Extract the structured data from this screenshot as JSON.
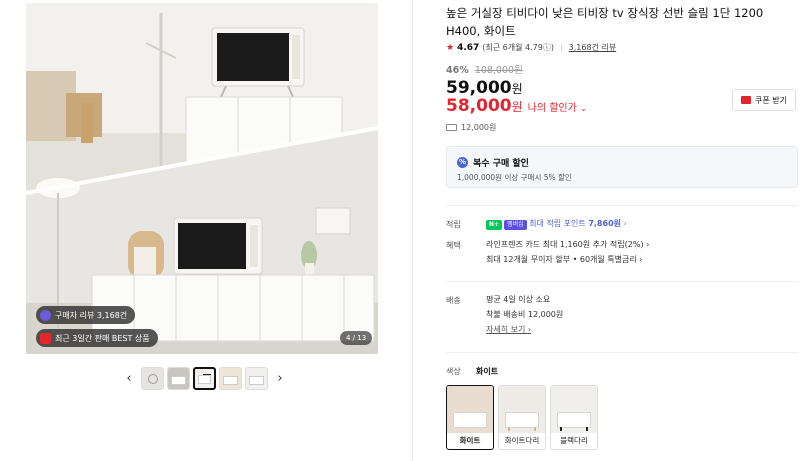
{
  "product": {
    "title": "높은 거실장 티비다이 낮은 티비장 tv 장식장 선반 슬림 1단 1200 H400, 화이트",
    "rating_score": "4.67",
    "rating_detail": "(최근 6개월 4.79ⓘ)",
    "review_count": "3,168건 리뷰",
    "discount_pct": "46%",
    "original_price": "108,000원",
    "price": "59,000",
    "price_won": "원",
    "my_price": "58,000",
    "my_price_won": "원",
    "my_discount_label": "나의 할인가",
    "coupon_label": "쿠폰 받기",
    "shipping_fee": "12,000원"
  },
  "gallery": {
    "badge_reviews": "구매자 리뷰 3,168건",
    "badge_best": "최근 3일간 판매 BEST 상품",
    "counter": "4 / 13",
    "prev": "‹",
    "next": "›"
  },
  "multi_discount": {
    "title": "복수 구매 할인",
    "detail": "1,000,000원 이상 구매시 5% 할인"
  },
  "points": {
    "label": "적립",
    "badge_n": "N+",
    "badge_m": "멤버십",
    "text": "최대 적립 포인트 ",
    "value": "7,860원",
    "chev": "›"
  },
  "benefits": {
    "label": "혜택",
    "line1": "라인프렌즈 카드 최대 1,160원 추가 적립(2%) ›",
    "line2": "최대 12개월 무이자 할부 • 60개월 특별금리 ›"
  },
  "delivery": {
    "label": "배송",
    "line1": "평균 4일 이상 소요",
    "line2": "착불 배송비 12,000원",
    "more": "자세히 보기 ›"
  },
  "color": {
    "label": "색상",
    "selected": "화이트",
    "options": [
      {
        "label": "화이트"
      },
      {
        "label": "화이트다리"
      },
      {
        "label": "블랙다리"
      }
    ]
  },
  "colors": {
    "accent_red": "#e4242f",
    "accent_blue": "#4a64d8",
    "naver_green": "#03c75a"
  }
}
